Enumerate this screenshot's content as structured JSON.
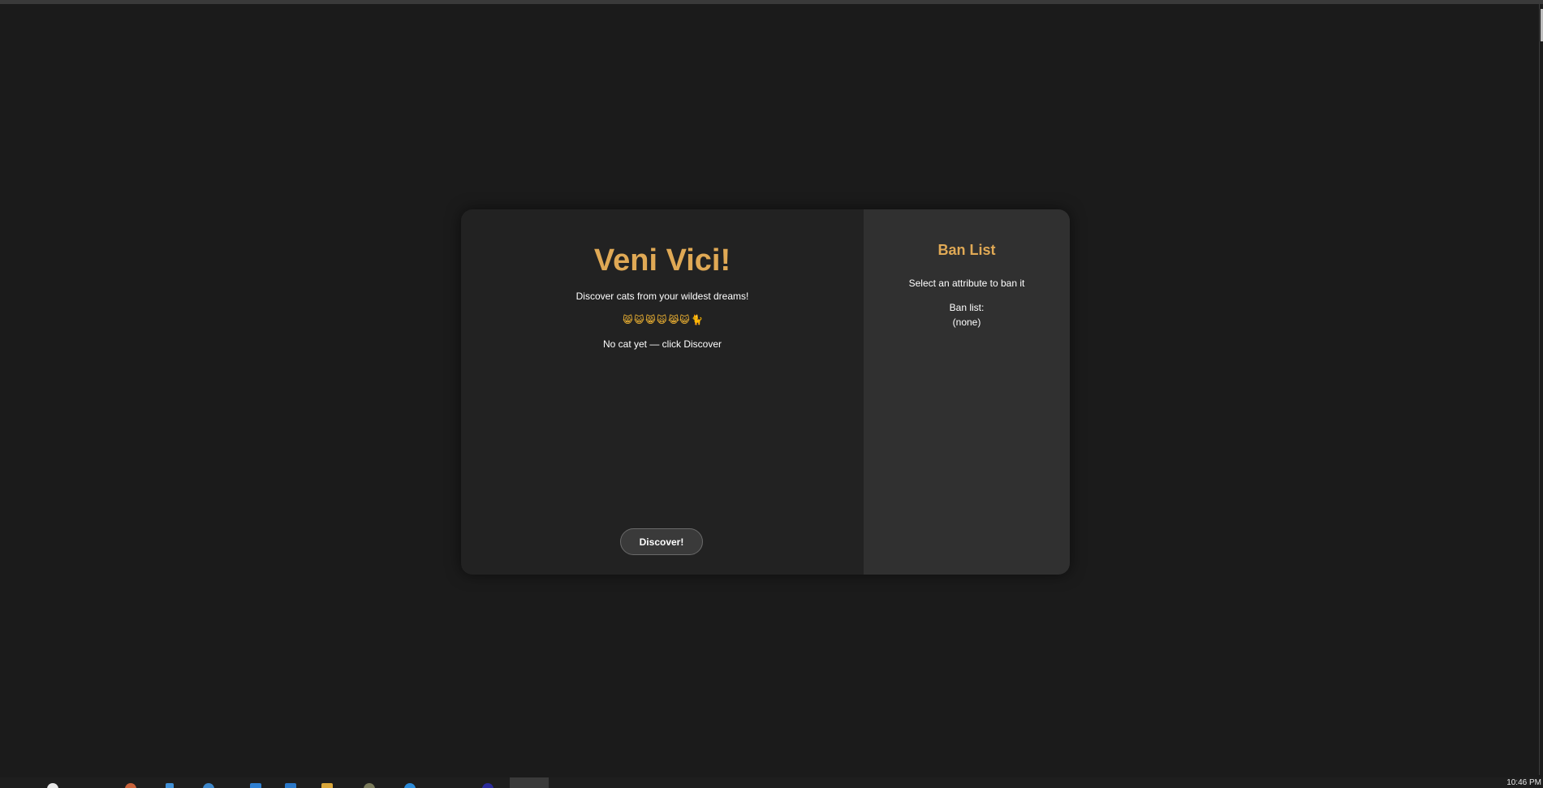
{
  "app": {
    "title": "Veni Vici!",
    "subtitle": "Discover cats from your wildest dreams!",
    "emojis": [
      "😸",
      "😺",
      "😸",
      "🙀",
      "😹",
      "😺",
      "🐈"
    ],
    "status": "No cat yet — click Discover",
    "discover_label": "Discover!"
  },
  "ban_panel": {
    "title": "Ban List",
    "hint": "Select an attribute to ban it",
    "list_label": "Ban list:",
    "list_value": "(none)"
  },
  "taskbar": {
    "clock": "10:46 PM",
    "icons": [
      "start-icon",
      "browser-icon",
      "file-icon",
      "edge-icon",
      "app-icon",
      "vscode-icon",
      "folder-icon",
      "settings-icon",
      "chrome-icon",
      "terminal-icon"
    ]
  },
  "colors": {
    "accent": "#e0a955",
    "background": "#1b1b1b",
    "main_panel": "#222222",
    "side_panel": "#303030"
  }
}
